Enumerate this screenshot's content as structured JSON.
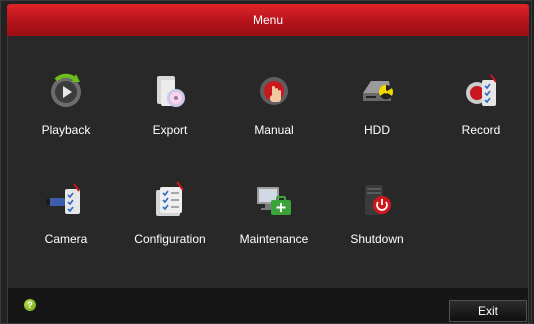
{
  "window": {
    "title": "Menu"
  },
  "menu": {
    "items": [
      {
        "label": "Playback",
        "icon": "playback-icon"
      },
      {
        "label": "Export",
        "icon": "export-icon"
      },
      {
        "label": "Manual",
        "icon": "manual-record-icon"
      },
      {
        "label": "HDD",
        "icon": "hdd-icon"
      },
      {
        "label": "Record",
        "icon": "record-icon"
      },
      {
        "label": "Camera",
        "icon": "camera-icon"
      },
      {
        "label": "Configuration",
        "icon": "configuration-icon"
      },
      {
        "label": "Maintenance",
        "icon": "maintenance-icon"
      },
      {
        "label": "Shutdown",
        "icon": "shutdown-icon"
      }
    ]
  },
  "footer": {
    "exit_label": "Exit",
    "help_icon": "help-icon"
  },
  "colors": {
    "title_bar": "#c4161c",
    "background": "#282828",
    "footer": "#161616"
  }
}
